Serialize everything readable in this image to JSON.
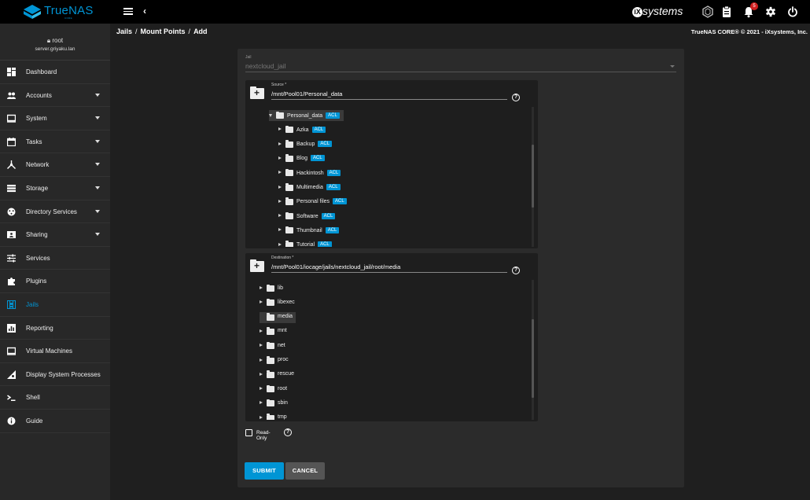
{
  "topbar": {
    "logo_text": "TrueNAS",
    "logo_sub": "CORE",
    "vendor": "systems",
    "vendor_mark": "iX",
    "notification_count": "5",
    "accent": "#0095d5"
  },
  "sidebar": {
    "user": "root",
    "host": "server.griyaku.lan",
    "items": [
      {
        "label": "Dashboard",
        "icon": "dashboard-icon",
        "chevron": false
      },
      {
        "label": "Accounts",
        "icon": "accounts-icon",
        "chevron": true
      },
      {
        "label": "System",
        "icon": "system-icon",
        "chevron": true
      },
      {
        "label": "Tasks",
        "icon": "tasks-icon",
        "chevron": true
      },
      {
        "label": "Network",
        "icon": "network-icon",
        "chevron": true
      },
      {
        "label": "Storage",
        "icon": "storage-icon",
        "chevron": true
      },
      {
        "label": "Directory Services",
        "icon": "directory-services-icon",
        "chevron": true
      },
      {
        "label": "Sharing",
        "icon": "sharing-icon",
        "chevron": true
      },
      {
        "label": "Services",
        "icon": "services-icon",
        "chevron": false
      },
      {
        "label": "Plugins",
        "icon": "plugins-icon",
        "chevron": false
      },
      {
        "label": "Jails",
        "icon": "jails-icon",
        "chevron": false,
        "active": true
      },
      {
        "label": "Reporting",
        "icon": "reporting-icon",
        "chevron": false
      },
      {
        "label": "Virtual Machines",
        "icon": "virtual-machines-icon",
        "chevron": false
      },
      {
        "label": "Display System Processes",
        "icon": "processes-icon",
        "chevron": false
      },
      {
        "label": "Shell",
        "icon": "shell-icon",
        "chevron": false
      },
      {
        "label": "Guide",
        "icon": "guide-icon",
        "chevron": false
      }
    ]
  },
  "breadcrumb": [
    "Jails",
    "Mount Points",
    "Add"
  ],
  "copyright": "TrueNAS CORE® © 2021 - iXsystems, Inc.",
  "form": {
    "jail_label": "Jail",
    "jail_value": "nextcloud_jail",
    "source": {
      "label": "Source *",
      "path": "/mnt/Pool01/Personal_data",
      "tree": [
        {
          "name": "Personal_data",
          "acl": "ACL",
          "depth": 0,
          "expanded": true,
          "selected": true
        },
        {
          "name": "Azka",
          "acl": "ACL",
          "depth": 1
        },
        {
          "name": "Backup",
          "acl": "ACL",
          "depth": 1
        },
        {
          "name": "Blog",
          "acl": "ACL",
          "depth": 1
        },
        {
          "name": "Hackintosh",
          "acl": "ACL",
          "depth": 1
        },
        {
          "name": "Multimedia",
          "acl": "ACL",
          "depth": 1
        },
        {
          "name": "Personal files",
          "acl": "ACL",
          "depth": 1
        },
        {
          "name": "Software",
          "acl": "ACL",
          "depth": 1
        },
        {
          "name": "Thumbnail",
          "acl": "ACL",
          "depth": 1
        },
        {
          "name": "Tutorial",
          "acl": "ACL",
          "depth": 1
        }
      ]
    },
    "destination": {
      "label": "Destination *",
      "path": "/mnt/Pool01/iocage/jails/nextcloud_jail/root/media",
      "tree": [
        {
          "name": "lib",
          "arrow": true
        },
        {
          "name": "libexec",
          "arrow": true
        },
        {
          "name": "media",
          "arrow": false,
          "selected": true
        },
        {
          "name": "mnt",
          "arrow": true
        },
        {
          "name": "net",
          "arrow": true
        },
        {
          "name": "proc",
          "arrow": true
        },
        {
          "name": "rescue",
          "arrow": true
        },
        {
          "name": "root",
          "arrow": true
        },
        {
          "name": "sbin",
          "arrow": true
        },
        {
          "name": "tmp",
          "arrow": true
        }
      ]
    },
    "readonly_label": "Read-Only",
    "help_glyph": "?",
    "submit_label": "SUBMIT",
    "cancel_label": "CANCEL"
  }
}
